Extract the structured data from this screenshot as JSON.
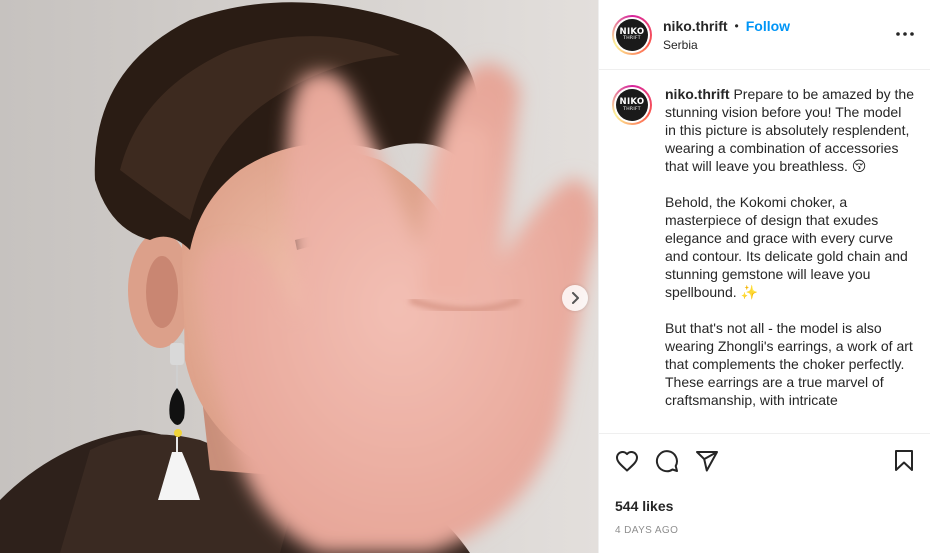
{
  "header": {
    "username": "niko.thrift",
    "separator": "•",
    "follow_label": "Follow",
    "location": "Serbia",
    "more_icon": "more-horizontal-icon"
  },
  "avatar": {
    "logo_top": "NIKO",
    "logo_bottom": "THRIFT"
  },
  "caption": {
    "username": "niko.thrift",
    "paragraphs": [
      "Prepare to be amazed by the stunning vision before you! The model in this picture is absolutely resplendent, wearing a combination of accessories that will leave you breathless. 😚",
      "Behold, the Kokomi choker, a masterpiece of design that exudes elegance and grace with every curve and contour. Its delicate gold chain and stunning gemstone will leave you spellbound. ✨",
      "But that's not all - the model is also wearing Zhongli's earrings, a work of art that complements the choker perfectly. These earrings are a true marvel of craftsmanship, with intricate"
    ]
  },
  "media": {
    "next_icon": "chevron-right-icon"
  },
  "actions": {
    "like_icon": "heart-icon",
    "comment_icon": "comment-icon",
    "share_icon": "send-icon",
    "save_icon": "bookmark-icon"
  },
  "stats": {
    "likes": "544 likes",
    "posted": "4 DAYS AGO"
  },
  "colors": {
    "follow": "#0095f6",
    "text": "#262626",
    "muted": "#8e8e8e",
    "border": "#efefef"
  }
}
